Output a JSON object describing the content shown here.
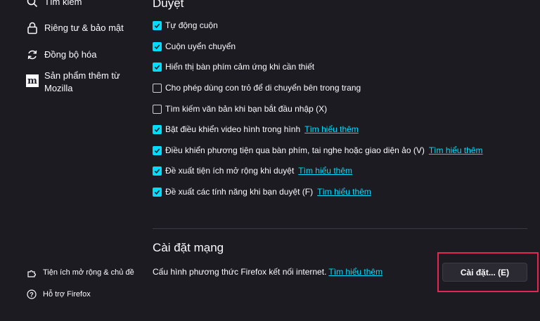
{
  "sidebar": {
    "items": [
      {
        "label": "Tìm kiếm",
        "icon": "search-icon"
      },
      {
        "label": "Riêng tư & bảo mật",
        "icon": "lock-icon"
      },
      {
        "label": "Đồng bộ hóa",
        "icon": "sync-icon"
      },
      {
        "label_line1": "Sản phẩm thêm từ",
        "label_line2": "Mozilla",
        "icon": "mozilla-icon",
        "icon_text": "m"
      }
    ],
    "bottom": [
      {
        "label": "Tiện ích mở rộng & chủ đề",
        "icon": "puzzle-icon"
      },
      {
        "label": "Hỗ trợ Firefox",
        "icon": "help-icon"
      }
    ]
  },
  "browsing": {
    "title": "Duyệt",
    "options": [
      {
        "label": "Tự động cuộn",
        "checked": true
      },
      {
        "label": "Cuộn uyển chuyển",
        "checked": true
      },
      {
        "label": "Hiển thị bàn phím cảm ứng khi cần thiết",
        "checked": true
      },
      {
        "label": "Cho phép dùng con trỏ để di chuyển bên trong trang",
        "checked": false
      },
      {
        "label": "Tìm kiếm văn bản khi bạn bắt đầu nhập (X)",
        "checked": false
      },
      {
        "label": "Bật điều khiển video hình trong hình",
        "checked": true,
        "link": "Tìm hiểu thêm"
      },
      {
        "label": "Điều khiển phương tiện qua bàn phím, tai nghe hoặc giao diện ảo (V)",
        "checked": true,
        "link": "Tìm hiểu thêm"
      },
      {
        "label": "Đề xuất tiện ích mở rộng khi duyệt",
        "checked": true,
        "link": "Tìm hiểu thêm"
      },
      {
        "label": "Đề xuất các tính năng khi bạn duyệt (F)",
        "checked": true,
        "link": "Tìm hiểu thêm"
      }
    ]
  },
  "network": {
    "title": "Cài đặt mạng",
    "description": "Cấu hình phương thức Firefox kết nối internet.",
    "link": "Tìm hiểu thêm",
    "button_label": "Cài đặt... (E)"
  },
  "colors": {
    "background": "#1c1b22",
    "accent": "#00ddff",
    "highlight": "#e22850"
  }
}
